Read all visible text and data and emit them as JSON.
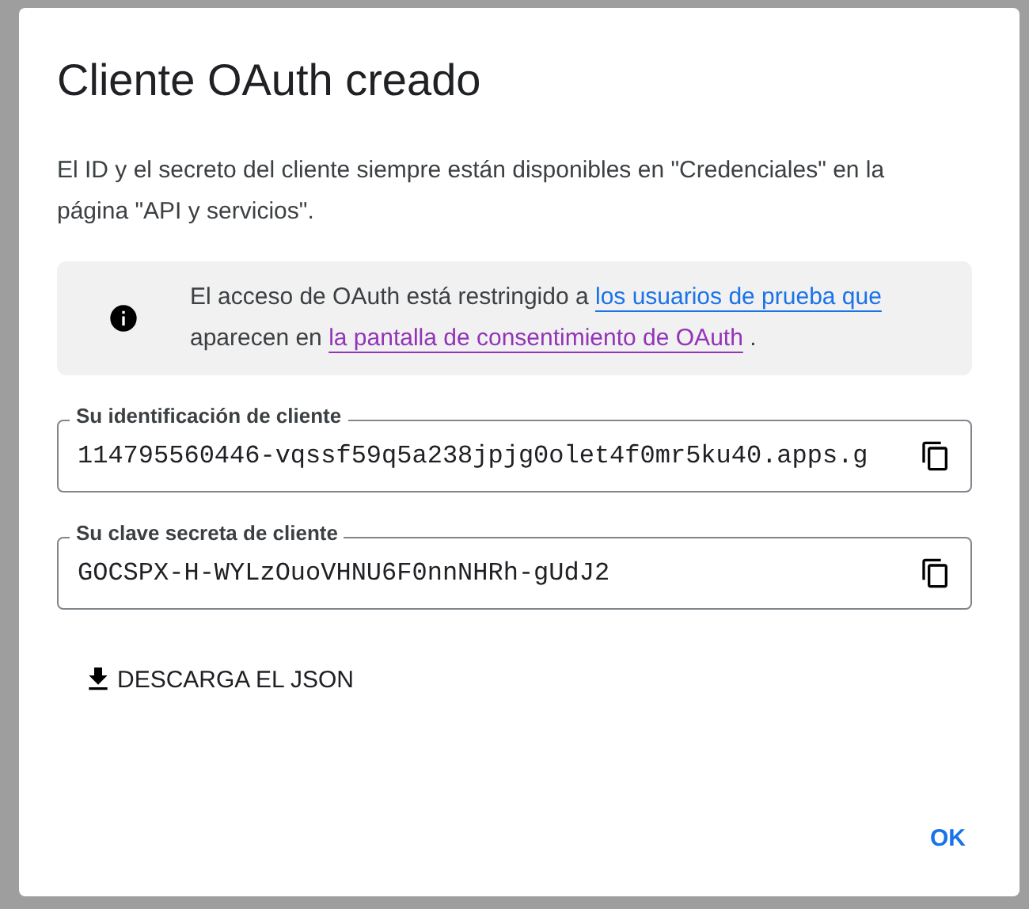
{
  "dialog": {
    "title": "Cliente OAuth creado",
    "description": "El ID y el secreto del cliente siempre están disponibles en \"Credenciales\" en la página \"API y servicios\".",
    "notice": {
      "text": "El acceso de OAuth está restringido a",
      "link_1": "los usuarios de prueba que",
      "middle": "aparecen en",
      "link_2": "la pantalla de consentimiento de OAuth",
      "end": "."
    },
    "fields": [
      {
        "label": "Su identificación de cliente",
        "value": "114795560446-vqssf59q5a238jpjg0olet4f0mr5ku40.apps.g"
      },
      {
        "label": "Su clave secreta de cliente",
        "value": "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"
      }
    ],
    "download_button": "DESCARGA EL JSON",
    "ok_button": "OK"
  }
}
